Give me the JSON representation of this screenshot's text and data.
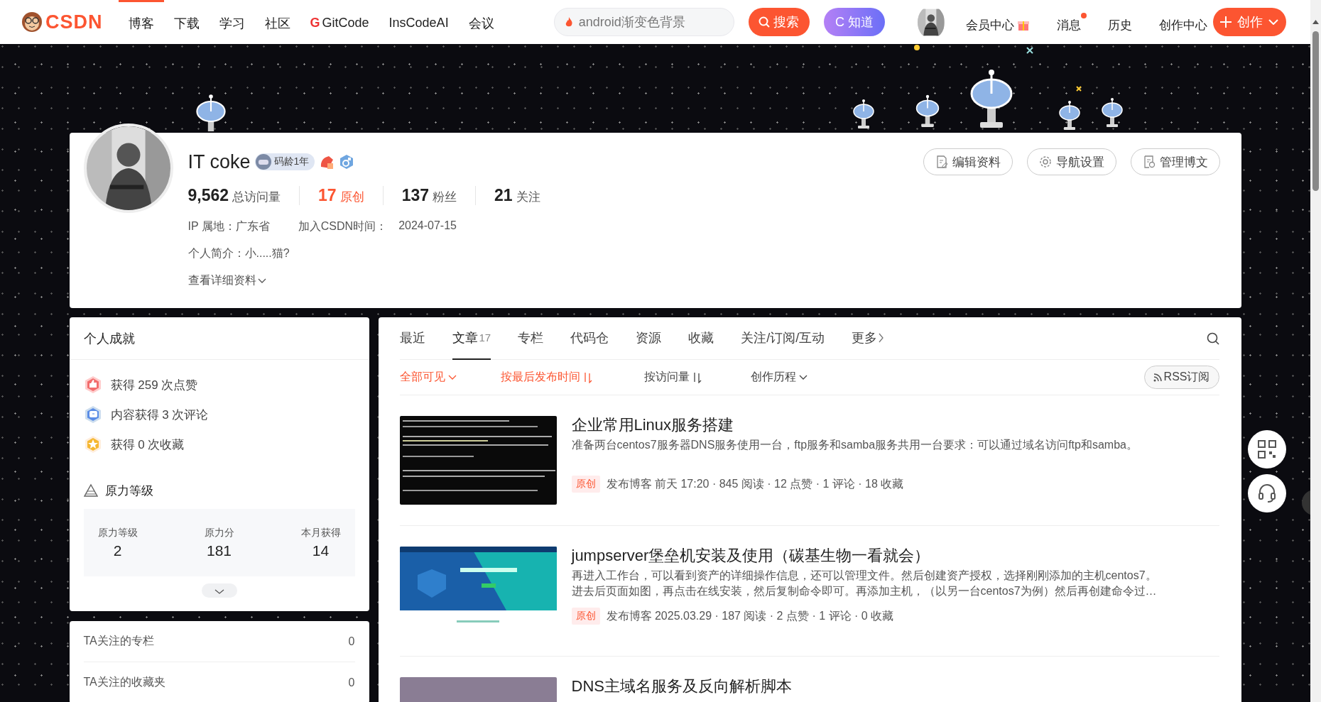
{
  "top_nav": {
    "logo": "CSDN",
    "links": [
      {
        "label": "博客",
        "selected": true
      },
      {
        "label": "下载",
        "selected": false
      },
      {
        "label": "学习",
        "selected": false
      },
      {
        "label": "社区",
        "selected": false
      },
      {
        "label": "GitCode",
        "mark": "G",
        "selected": false
      },
      {
        "label": "InsCodeAI",
        "selected": false
      },
      {
        "label": "会议",
        "selected": false
      }
    ],
    "search": {
      "placeholder": "android渐变色背景"
    },
    "search_button": "搜索",
    "ask_button": "C 知道",
    "user_links": [
      {
        "label": "会员中心",
        "kind": "gift",
        "unread": false
      },
      {
        "label": "消息",
        "kind": "plain",
        "unread": true
      },
      {
        "label": "历史",
        "kind": "plain",
        "unread": false
      },
      {
        "label": "创作中心",
        "kind": "plain",
        "unread": false
      }
    ],
    "create_button": "创作"
  },
  "profile": {
    "name": "IT coke",
    "code_age": "码龄1年",
    "stats": [
      {
        "value": "9,562",
        "label": "总访问量",
        "highlight": false
      },
      {
        "value": "17",
        "label": "原创",
        "highlight": true
      },
      {
        "value": "137",
        "label": "粉丝",
        "highlight": false
      },
      {
        "value": "21",
        "label": "关注",
        "highlight": false
      }
    ],
    "ip": "IP 属地：广东省",
    "joined_label": "加入CSDN时间：",
    "joined": "2024-07-15",
    "bio": "个人简介：小.....猫?",
    "details_link": "查看详细资料",
    "actions": [
      {
        "label": "编辑资料",
        "kind": "edit"
      },
      {
        "label": "导航设置",
        "kind": "gear"
      },
      {
        "label": "管理博文",
        "kind": "manage"
      }
    ]
  },
  "sidebar": {
    "achievements": {
      "title": "个人成就",
      "items": [
        {
          "text": "获得 259 次点赞",
          "kind": "like"
        },
        {
          "text": "内容获得 3 次评论",
          "kind": "comment"
        },
        {
          "text": "获得 0 次收藏",
          "kind": "favorite"
        }
      ],
      "level_title": "原力等级",
      "level_stats": [
        {
          "label": "原力等级",
          "value": "2"
        },
        {
          "label": "原力分",
          "value": "181"
        },
        {
          "label": "本月获得",
          "value": "14"
        }
      ]
    },
    "follows": [
      {
        "label": "TA关注的专栏",
        "count": "0"
      },
      {
        "label": "TA关注的收藏夹",
        "count": "0"
      }
    ]
  },
  "main": {
    "tabs": [
      {
        "label": "最近",
        "selected": false
      },
      {
        "label": "文章",
        "count": "17",
        "selected": true
      },
      {
        "label": "专栏",
        "selected": false
      },
      {
        "label": "代码仓",
        "selected": false
      },
      {
        "label": "资源",
        "selected": false
      },
      {
        "label": "收藏",
        "selected": false
      },
      {
        "label": "关注/订阅/互动",
        "selected": false
      },
      {
        "label": "更多",
        "kind": "more",
        "selected": false
      }
    ],
    "filters": [
      {
        "label": "全部可见",
        "kind": "dropdown",
        "active": true
      },
      {
        "label": "按最后发布时间",
        "kind": "sort",
        "active": true
      },
      {
        "label": "按访问量",
        "kind": "sort",
        "active": false
      },
      {
        "label": "创作历程",
        "kind": "dropdown",
        "active": false
      }
    ],
    "rss_button": "RSS订阅",
    "articles": [
      {
        "title": "企业常用Linux服务搭建",
        "summary_lines": [
          "准备两台centos7服务器DNS服务使用一台，ftp服务和samba服务共用一台要求：可以通过域名访问ftp和samba。"
        ],
        "tag": "原创",
        "meta": "发布博客 前天 17:20 · 845 阅读 · 12 点赞 · 1 评论 · 18 收藏"
      },
      {
        "title": "jumpserver堡垒机安装及使用（碳基生物一看就会）",
        "summary_lines": [
          "再进入工作台，可以看到资产的详细操作信息，还可以管理文件。然后创建资产授权，选择刚刚添加的主机centos7。",
          "进去后页面如图，再点击在线安装，然后复制命令即可。再添加主机，（以另一台centos7为例）然后再创建命令过…"
        ],
        "tag": "原创",
        "meta": "发布博客 2025.03.29 · 187 阅读 · 2 点赞 · 1 评论 · 0 收藏"
      },
      {
        "title": "DNS主域名服务及反向解析脚本"
      }
    ]
  }
}
